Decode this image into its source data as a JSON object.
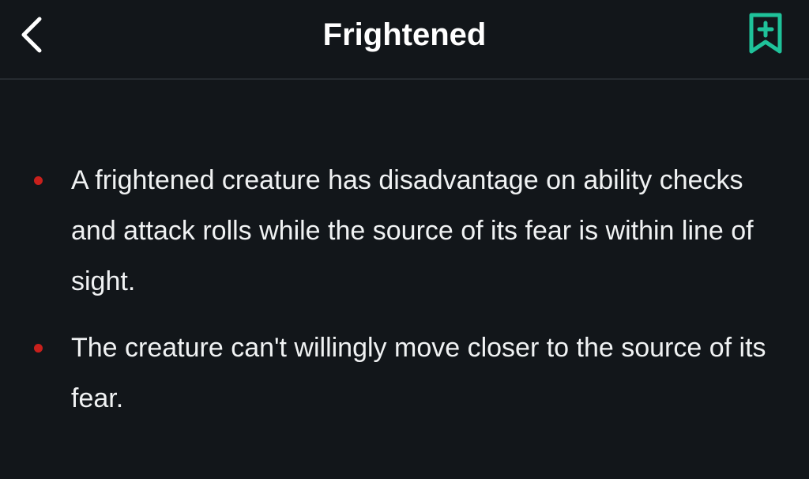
{
  "header": {
    "title": "Frightened",
    "back_icon": "chevron-left-icon",
    "bookmark_icon": "bookmark-add-icon",
    "accent_color": "#1fc29a"
  },
  "content": {
    "bullets": [
      {
        "text": "A frightened creature has disadvantage on ability checks and attack rolls while the source of its fear is within line of sight."
      },
      {
        "text": "The creature can't willingly move closer to the source of its fear."
      }
    ],
    "bullet_color": "#c8201c"
  }
}
